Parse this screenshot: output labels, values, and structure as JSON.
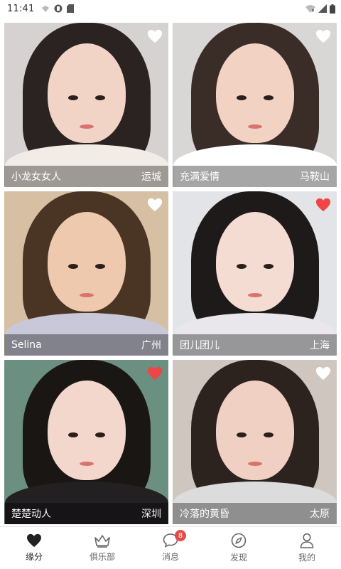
{
  "status": {
    "time": "11:41"
  },
  "colors": {
    "liked": "#f04545",
    "unliked": "#ffffff",
    "active": "#222222",
    "badge": "#e84a4a"
  },
  "cards": [
    {
      "name": "小龙女女人",
      "city": "运城",
      "liked": false,
      "bg": "#d7d2d2",
      "hair": "#2b2321",
      "skin": "#f2d4c7",
      "shirt": "#f1ede6"
    },
    {
      "name": "充满爱情",
      "city": "马鞍山",
      "liked": false,
      "bg": "#d9d7d6",
      "hair": "#3a2d28",
      "skin": "#f1d2c3",
      "shirt": "#ffffff"
    },
    {
      "name": "Selina",
      "city": "广州",
      "liked": false,
      "bg": "#d6bfa2",
      "hair": "#4a3424",
      "skin": "#efc9ad",
      "shirt": "#c8c8d8"
    },
    {
      "name": "团儿团儿",
      "city": "上海",
      "liked": true,
      "bg": "#e3e4e8",
      "hair": "#1f1a1a",
      "skin": "#f5dcd3",
      "shirt": "#e9e6ec"
    },
    {
      "name": "楚楚动人",
      "city": "深圳",
      "liked": true,
      "bg": "#6b8f80",
      "hair": "#1a1614",
      "skin": "#f3d7cc",
      "shirt": "#232022"
    },
    {
      "name": "冷落的黄昏",
      "city": "太原",
      "liked": false,
      "bg": "#cfc6c0",
      "hair": "#2c221e",
      "skin": "#efd0c3",
      "shirt": "#dcdcdc"
    }
  ],
  "nav": [
    {
      "label": "缘分",
      "icon": "heart-icon",
      "active": true
    },
    {
      "label": "俱乐部",
      "icon": "crown-icon",
      "active": false
    },
    {
      "label": "消息",
      "icon": "chat-icon",
      "active": false,
      "badge": "8"
    },
    {
      "label": "发现",
      "icon": "compass-icon",
      "active": false
    },
    {
      "label": "我的",
      "icon": "person-icon",
      "active": false
    }
  ]
}
